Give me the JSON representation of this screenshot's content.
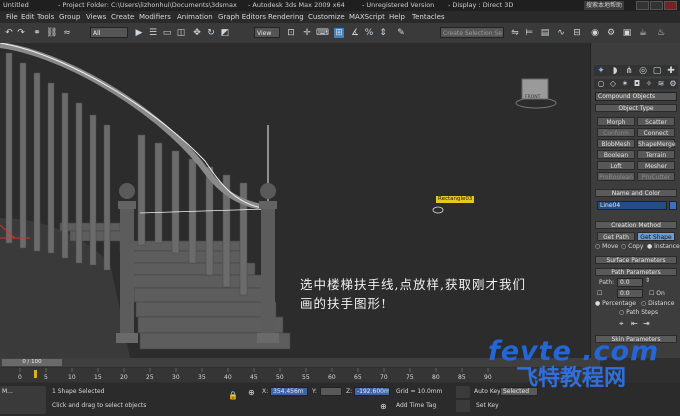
{
  "titlebar": {
    "file": "Untitled",
    "project": "- Project Folder: C:\\Users\\lizhonhui\\Documents\\3dsmax",
    "app": "- Autodesk 3ds Max  2009 x64",
    "license": "- Unregistered Version",
    "display": "- Display : Direct 3D",
    "right_label": "搜索本地帮助"
  },
  "menu": [
    "File",
    "Edit",
    "Tools",
    "Group",
    "Views",
    "Create",
    "Modifiers",
    "Animation",
    "Graph Editors",
    "Rendering",
    "Customize",
    "MAXScript",
    "Help",
    "Tentacles"
  ],
  "toolbar": {
    "filter_value": "All",
    "refcoord_value": "View",
    "selection_set_placeholder": "Create Selection Se"
  },
  "viewport": {
    "label": "Rectangle03",
    "viewcube_label": "FRONT",
    "caption_line1": "选中楼梯扶手线,点放样,获取刚才我们",
    "caption_line2": "画的扶手图形!"
  },
  "command_panel": {
    "category": "Compound Objects",
    "object_type_title": "Object Type",
    "buttons": [
      "Morph",
      "Scatter",
      "Conform",
      "Connect",
      "BlobMesh",
      "ShapeMerge",
      "Boolean",
      "Terrain",
      "Loft",
      "Mesher",
      "ProBoolean",
      "ProCutter"
    ],
    "name_color_title": "Name and Color",
    "object_name": "Line04",
    "creation_method_title": "Creation Method",
    "get_path": "Get Path",
    "get_shape": "Get Shape",
    "move": "Move",
    "copy": "Copy",
    "instance": "Instance",
    "surface_params_title": "Surface Parameters",
    "path_params_title": "Path Parameters",
    "path_label": "Path:",
    "path_value": "0.0",
    "snap_value": "0.0",
    "on_label": "On",
    "percentage": "Percentage",
    "distance": "Distance",
    "path_steps": "Path Steps",
    "skin_params_title": "Skin Parameters"
  },
  "timeline": {
    "frame_counter": "0 / 100",
    "ticks": [
      "0",
      "5",
      "10",
      "15",
      "20",
      "25",
      "30",
      "35",
      "40",
      "45",
      "50",
      "55",
      "60",
      "65",
      "70",
      "75",
      "80",
      "85",
      "90"
    ]
  },
  "statusbar": {
    "selection": "1 Shape Selected",
    "prompt": "Click and drag to select objects",
    "x_label": "X:",
    "x_value": "354.456m",
    "y_label": "Y:",
    "z_label": "Z:",
    "z_value": "-192.600m",
    "grid": "Grid = 10.0mm",
    "add_time_tag": "Add Time Tag",
    "auto_key": "Auto Key",
    "set_key": "Set Key",
    "selected": "Selected",
    "max_label": "M..."
  },
  "watermark": {
    "domain": "fevte .com",
    "cn": "飞特教程网"
  }
}
